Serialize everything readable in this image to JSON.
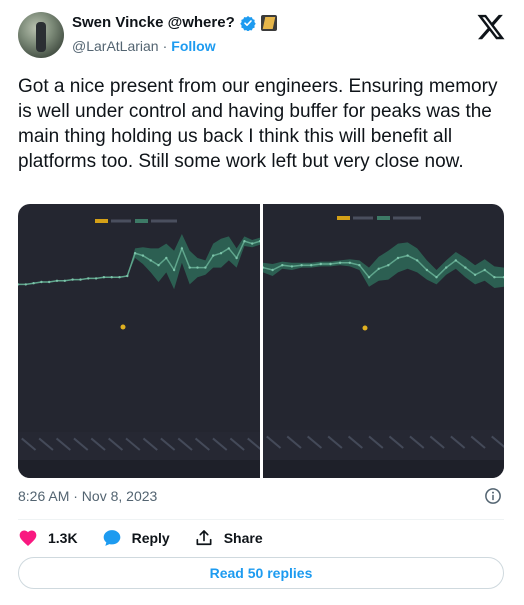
{
  "author": {
    "name": "Swen Vincke @where?",
    "handle": "@LarAtLarian",
    "separator": "·",
    "follow_label": "Follow"
  },
  "tweet": {
    "text": "Got a nice present from our engineers. Ensuring memory is well under control and having buffer for peaks was the main thing holding us back I think this will benefit all platforms too. Still some work left but very close now.",
    "timestamp": "8:26 AM · Nov 8, 2023"
  },
  "actions": {
    "likes": "1.3K",
    "reply_label": "Reply",
    "share_label": "Share"
  },
  "replies_button": "Read 50 replies",
  "colors": {
    "like": "#f91880",
    "accent": "#1d9bf0",
    "chart_bg": "#242630",
    "series_line": "#3d7a66",
    "series_band": "#2e6a58",
    "marker": "#e0b020"
  },
  "icons": {
    "verified": "verified-badge-icon",
    "logo": "x-logo-icon",
    "info": "info-icon",
    "like": "heart-icon",
    "reply": "speech-bubble-icon",
    "share": "upload-share-icon"
  },
  "chart_data": [
    {
      "type": "line",
      "title": "",
      "legend": "top-center",
      "series": [
        {
          "values": [
            58,
            58,
            59,
            60,
            60,
            61,
            61,
            62,
            62,
            63,
            63,
            64,
            64,
            64,
            65,
            84,
            82,
            78,
            74,
            80,
            70,
            88,
            72,
            72,
            72,
            82,
            84,
            88,
            80,
            94,
            92,
            94
          ]
        }
      ]
    },
    {
      "type": "line",
      "title": "",
      "legend": "top-center",
      "series": [
        {
          "values": [
            72,
            70,
            74,
            73,
            74,
            74,
            75,
            75,
            76,
            76,
            74,
            64,
            71,
            74,
            80,
            82,
            78,
            70,
            64,
            72,
            78,
            72,
            66,
            70,
            64,
            64
          ]
        }
      ]
    }
  ]
}
